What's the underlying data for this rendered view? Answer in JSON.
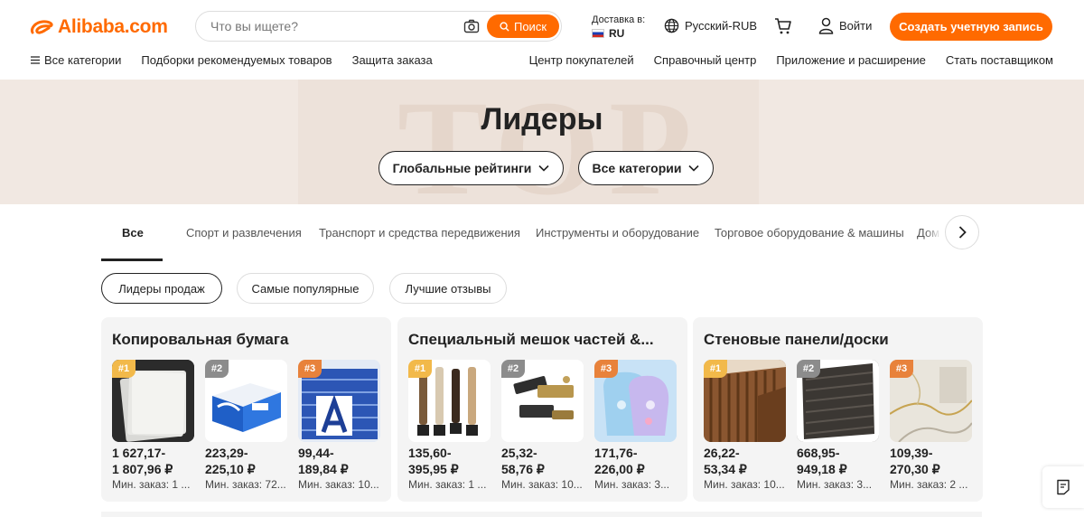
{
  "header": {
    "logo_text": "Alibaba.com",
    "search_placeholder": "Что вы ищете?",
    "search_button": "Поиск",
    "deliver_label": "Доставка в:",
    "deliver_country": "RU",
    "language": "Русский-RUB",
    "signin": "Войти",
    "create_account": "Создать учетную запись"
  },
  "nav": {
    "left": [
      "Все категории",
      "Подборки рекомендуемых товаров",
      "Защита заказа"
    ],
    "right": [
      "Центр покупателей",
      "Справочный центр",
      "Приложение и расширение",
      "Стать поставщиком"
    ]
  },
  "banner": {
    "ghost_text": "TOP",
    "title": "Лидеры",
    "pill_rankings": "Глобальные рейтинги",
    "pill_categories": "Все категории"
  },
  "tabs": [
    "Все",
    "Спорт и развлечения",
    "Транспорт и средства передвижения",
    "Инструменты и оборудование",
    "Торговое оборудование & машины",
    "Дом"
  ],
  "subfilters": [
    "Лидеры продаж",
    "Самые популярные",
    "Лучшие отзывы"
  ],
  "cards": [
    {
      "title": "Копировальная бумага",
      "products": [
        {
          "rank": "#1",
          "price": "1 627,17-\n1 807,96 ₽",
          "moq": "Мин. заказ: 1 ..."
        },
        {
          "rank": "#2",
          "price": "223,29-\n225,10 ₽",
          "moq": "Мин. заказ: 72..."
        },
        {
          "rank": "#3",
          "price": "99,44-\n189,84 ₽",
          "moq": "Мин. заказ: 10..."
        }
      ]
    },
    {
      "title": "Специальный мешок частей &...",
      "products": [
        {
          "rank": "#1",
          "price": "135,60-\n395,95 ₽",
          "moq": "Мин. заказ: 1 ..."
        },
        {
          "rank": "#2",
          "price": "25,32-\n58,76 ₽",
          "moq": "Мин. заказ: 10..."
        },
        {
          "rank": "#3",
          "price": "171,76-\n226,00 ₽",
          "moq": "Мин. заказ: 3..."
        }
      ]
    },
    {
      "title": "Стеновые панели/доски",
      "products": [
        {
          "rank": "#1",
          "price": "26,22-\n53,34 ₽",
          "moq": "Мин. заказ: 10..."
        },
        {
          "rank": "#2",
          "price": "668,95-\n949,18 ₽",
          "moq": "Мин. заказ: 3..."
        },
        {
          "rank": "#3",
          "price": "109,39-\n270,30 ₽",
          "moq": "Мин. заказ: 2 ..."
        }
      ]
    }
  ],
  "colors": {
    "accent": "#ff6a00",
    "rank1": "#f2b94a",
    "rank2": "#8c8c8c",
    "rank3": "#e8823b"
  }
}
